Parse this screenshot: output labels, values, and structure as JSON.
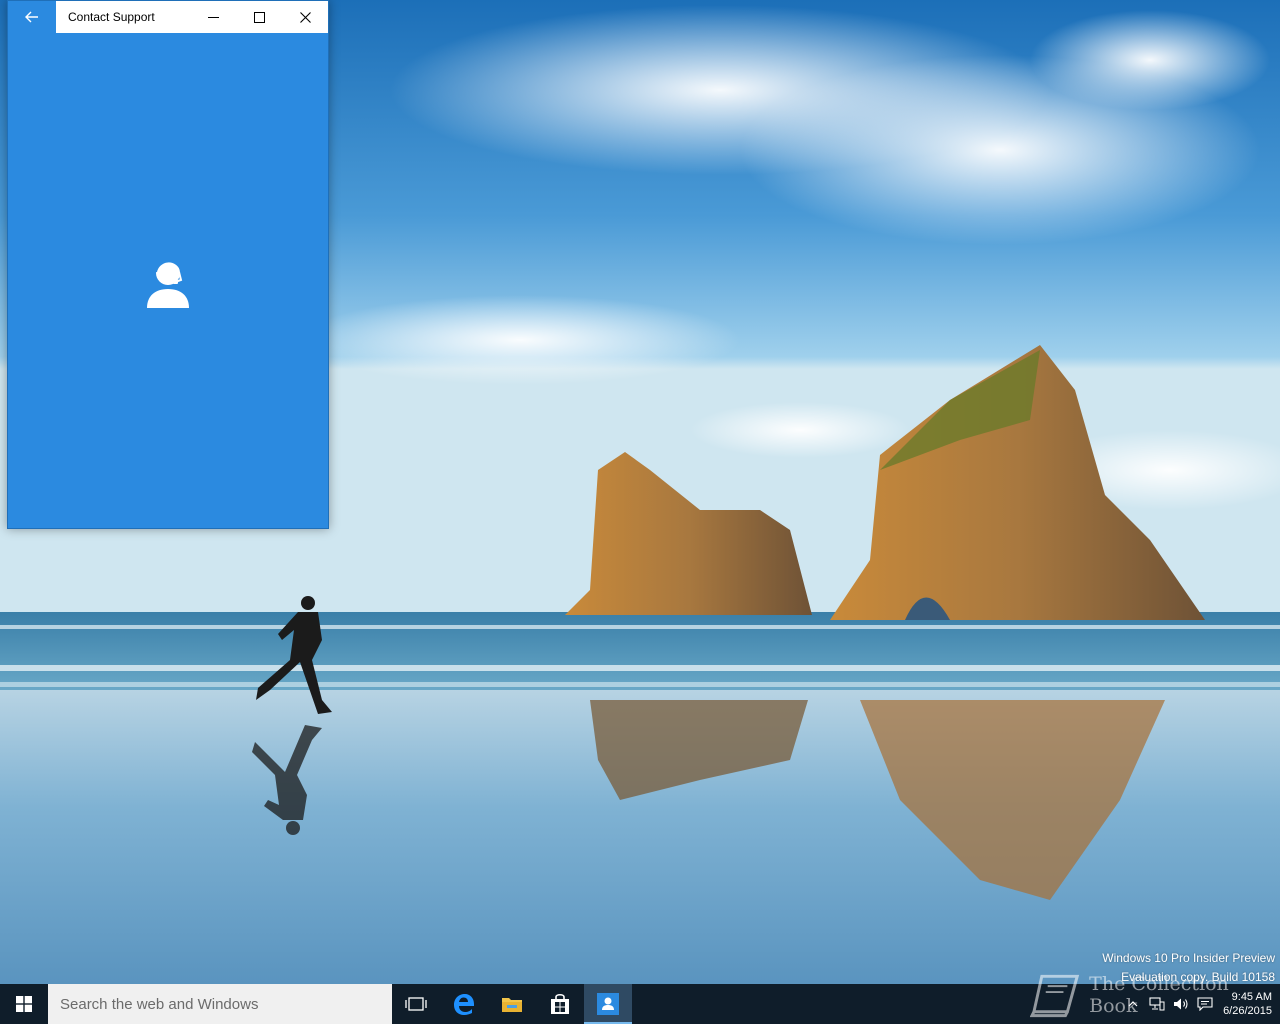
{
  "window": {
    "title": "Contact Support",
    "accent_color": "#2b8ae0",
    "icons": [
      "back-arrow-icon",
      "minimize-icon",
      "maximize-icon",
      "close-icon",
      "support-agent-icon"
    ]
  },
  "watermark": {
    "line1": "Windows 10 Pro Insider Preview",
    "line2": "Evaluation copy. Build 10158"
  },
  "taskbar": {
    "search_placeholder": "Search the web and Windows",
    "apps": [
      "task-view",
      "edge",
      "file-explorer",
      "store",
      "contact-support"
    ],
    "active_app": "contact-support"
  },
  "clock": {
    "time": "9:45 AM",
    "date": "6/26/2015"
  },
  "brand": {
    "text": "The Collection Book"
  }
}
